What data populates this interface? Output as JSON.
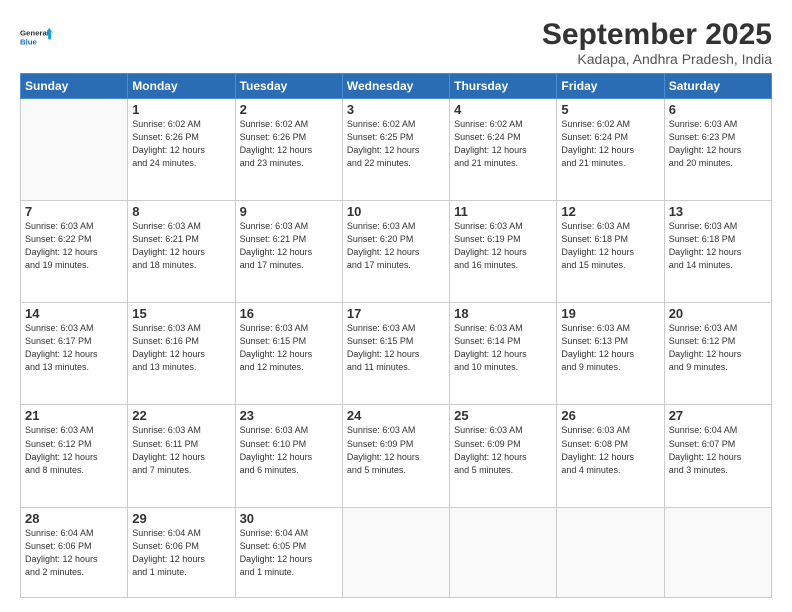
{
  "header": {
    "logo_line1": "General",
    "logo_line2": "Blue",
    "title": "September 2025",
    "subtitle": "Kadapa, Andhra Pradesh, India"
  },
  "weekdays": [
    "Sunday",
    "Monday",
    "Tuesday",
    "Wednesday",
    "Thursday",
    "Friday",
    "Saturday"
  ],
  "weeks": [
    [
      {
        "day": "",
        "info": ""
      },
      {
        "day": "1",
        "info": "Sunrise: 6:02 AM\nSunset: 6:26 PM\nDaylight: 12 hours\nand 24 minutes."
      },
      {
        "day": "2",
        "info": "Sunrise: 6:02 AM\nSunset: 6:26 PM\nDaylight: 12 hours\nand 23 minutes."
      },
      {
        "day": "3",
        "info": "Sunrise: 6:02 AM\nSunset: 6:25 PM\nDaylight: 12 hours\nand 22 minutes."
      },
      {
        "day": "4",
        "info": "Sunrise: 6:02 AM\nSunset: 6:24 PM\nDaylight: 12 hours\nand 21 minutes."
      },
      {
        "day": "5",
        "info": "Sunrise: 6:02 AM\nSunset: 6:24 PM\nDaylight: 12 hours\nand 21 minutes."
      },
      {
        "day": "6",
        "info": "Sunrise: 6:03 AM\nSunset: 6:23 PM\nDaylight: 12 hours\nand 20 minutes."
      }
    ],
    [
      {
        "day": "7",
        "info": "Sunrise: 6:03 AM\nSunset: 6:22 PM\nDaylight: 12 hours\nand 19 minutes."
      },
      {
        "day": "8",
        "info": "Sunrise: 6:03 AM\nSunset: 6:21 PM\nDaylight: 12 hours\nand 18 minutes."
      },
      {
        "day": "9",
        "info": "Sunrise: 6:03 AM\nSunset: 6:21 PM\nDaylight: 12 hours\nand 17 minutes."
      },
      {
        "day": "10",
        "info": "Sunrise: 6:03 AM\nSunset: 6:20 PM\nDaylight: 12 hours\nand 17 minutes."
      },
      {
        "day": "11",
        "info": "Sunrise: 6:03 AM\nSunset: 6:19 PM\nDaylight: 12 hours\nand 16 minutes."
      },
      {
        "day": "12",
        "info": "Sunrise: 6:03 AM\nSunset: 6:18 PM\nDaylight: 12 hours\nand 15 minutes."
      },
      {
        "day": "13",
        "info": "Sunrise: 6:03 AM\nSunset: 6:18 PM\nDaylight: 12 hours\nand 14 minutes."
      }
    ],
    [
      {
        "day": "14",
        "info": "Sunrise: 6:03 AM\nSunset: 6:17 PM\nDaylight: 12 hours\nand 13 minutes."
      },
      {
        "day": "15",
        "info": "Sunrise: 6:03 AM\nSunset: 6:16 PM\nDaylight: 12 hours\nand 13 minutes."
      },
      {
        "day": "16",
        "info": "Sunrise: 6:03 AM\nSunset: 6:15 PM\nDaylight: 12 hours\nand 12 minutes."
      },
      {
        "day": "17",
        "info": "Sunrise: 6:03 AM\nSunset: 6:15 PM\nDaylight: 12 hours\nand 11 minutes."
      },
      {
        "day": "18",
        "info": "Sunrise: 6:03 AM\nSunset: 6:14 PM\nDaylight: 12 hours\nand 10 minutes."
      },
      {
        "day": "19",
        "info": "Sunrise: 6:03 AM\nSunset: 6:13 PM\nDaylight: 12 hours\nand 9 minutes."
      },
      {
        "day": "20",
        "info": "Sunrise: 6:03 AM\nSunset: 6:12 PM\nDaylight: 12 hours\nand 9 minutes."
      }
    ],
    [
      {
        "day": "21",
        "info": "Sunrise: 6:03 AM\nSunset: 6:12 PM\nDaylight: 12 hours\nand 8 minutes."
      },
      {
        "day": "22",
        "info": "Sunrise: 6:03 AM\nSunset: 6:11 PM\nDaylight: 12 hours\nand 7 minutes."
      },
      {
        "day": "23",
        "info": "Sunrise: 6:03 AM\nSunset: 6:10 PM\nDaylight: 12 hours\nand 6 minutes."
      },
      {
        "day": "24",
        "info": "Sunrise: 6:03 AM\nSunset: 6:09 PM\nDaylight: 12 hours\nand 5 minutes."
      },
      {
        "day": "25",
        "info": "Sunrise: 6:03 AM\nSunset: 6:09 PM\nDaylight: 12 hours\nand 5 minutes."
      },
      {
        "day": "26",
        "info": "Sunrise: 6:03 AM\nSunset: 6:08 PM\nDaylight: 12 hours\nand 4 minutes."
      },
      {
        "day": "27",
        "info": "Sunrise: 6:04 AM\nSunset: 6:07 PM\nDaylight: 12 hours\nand 3 minutes."
      }
    ],
    [
      {
        "day": "28",
        "info": "Sunrise: 6:04 AM\nSunset: 6:06 PM\nDaylight: 12 hours\nand 2 minutes."
      },
      {
        "day": "29",
        "info": "Sunrise: 6:04 AM\nSunset: 6:06 PM\nDaylight: 12 hours\nand 1 minute."
      },
      {
        "day": "30",
        "info": "Sunrise: 6:04 AM\nSunset: 6:05 PM\nDaylight: 12 hours\nand 1 minute."
      },
      {
        "day": "",
        "info": ""
      },
      {
        "day": "",
        "info": ""
      },
      {
        "day": "",
        "info": ""
      },
      {
        "day": "",
        "info": ""
      }
    ]
  ]
}
